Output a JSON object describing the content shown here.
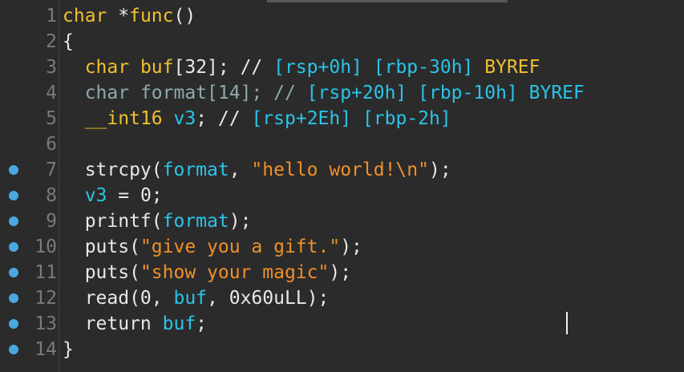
{
  "lines": [
    {
      "num": "1",
      "bp": false,
      "parts": [
        [
          "kw",
          "char"
        ],
        [
          "punct",
          " *"
        ],
        [
          "id",
          "func"
        ],
        [
          "punct",
          "()"
        ]
      ]
    },
    {
      "num": "2",
      "bp": false,
      "parts": [
        [
          "punct",
          "{"
        ]
      ]
    },
    {
      "num": "3",
      "bp": false,
      "parts": [
        [
          "punct",
          "  "
        ],
        [
          "kw",
          "char"
        ],
        [
          "punct",
          " "
        ],
        [
          "id",
          "buf"
        ],
        [
          "punct",
          "[32]; // "
        ],
        [
          "addr",
          "[rsp+0h]"
        ],
        [
          "punct",
          " "
        ],
        [
          "addr",
          "[rbp-30h]"
        ],
        [
          "punct",
          " "
        ],
        [
          "id",
          "BYREF"
        ]
      ]
    },
    {
      "num": "4",
      "bp": false,
      "parts": [
        [
          "punct",
          "  "
        ],
        [
          "faded",
          "char format[14]; // "
        ],
        [
          "addr",
          "[rsp+20h]"
        ],
        [
          "punct",
          " "
        ],
        [
          "addr",
          "[rbp-10h]"
        ],
        [
          "punct",
          " "
        ],
        [
          "addr",
          "BYREF"
        ]
      ]
    },
    {
      "num": "5",
      "bp": false,
      "parts": [
        [
          "punct",
          "  "
        ],
        [
          "id",
          "__int16"
        ],
        [
          "punct",
          " "
        ],
        [
          "addr",
          "v3"
        ],
        [
          "punct",
          "; // "
        ],
        [
          "addr",
          "[rsp+2Eh]"
        ],
        [
          "punct",
          " "
        ],
        [
          "addr",
          "[rbp-2h]"
        ]
      ]
    },
    {
      "num": "6",
      "bp": false,
      "parts": []
    },
    {
      "num": "7",
      "bp": true,
      "parts": [
        [
          "punct",
          "  strcpy("
        ],
        [
          "addr",
          "format"
        ],
        [
          "punct",
          ", "
        ],
        [
          "str",
          "\"hello world!\\n\""
        ],
        [
          "punct",
          ");"
        ]
      ]
    },
    {
      "num": "8",
      "bp": true,
      "parts": [
        [
          "punct",
          "  "
        ],
        [
          "addr",
          "v3"
        ],
        [
          "punct",
          " = 0;"
        ]
      ]
    },
    {
      "num": "9",
      "bp": true,
      "parts": [
        [
          "punct",
          "  printf("
        ],
        [
          "addr",
          "format"
        ],
        [
          "punct",
          ");"
        ]
      ]
    },
    {
      "num": "10",
      "bp": true,
      "parts": [
        [
          "punct",
          "  puts("
        ],
        [
          "str",
          "\"give you a gift.\""
        ],
        [
          "punct",
          ");"
        ]
      ]
    },
    {
      "num": "11",
      "bp": true,
      "parts": [
        [
          "punct",
          "  puts("
        ],
        [
          "str",
          "\"show your magic\""
        ],
        [
          "punct",
          ");"
        ]
      ]
    },
    {
      "num": "12",
      "bp": true,
      "parts": [
        [
          "punct",
          "  read(0, "
        ],
        [
          "addr",
          "buf"
        ],
        [
          "punct",
          ", 0x60uLL);"
        ]
      ]
    },
    {
      "num": "13",
      "bp": true,
      "parts": [
        [
          "punct",
          "  return "
        ],
        [
          "addr",
          "buf"
        ],
        [
          "punct",
          ";"
        ]
      ]
    },
    {
      "num": "14",
      "bp": true,
      "parts": [
        [
          "punct",
          "}"
        ]
      ]
    }
  ]
}
